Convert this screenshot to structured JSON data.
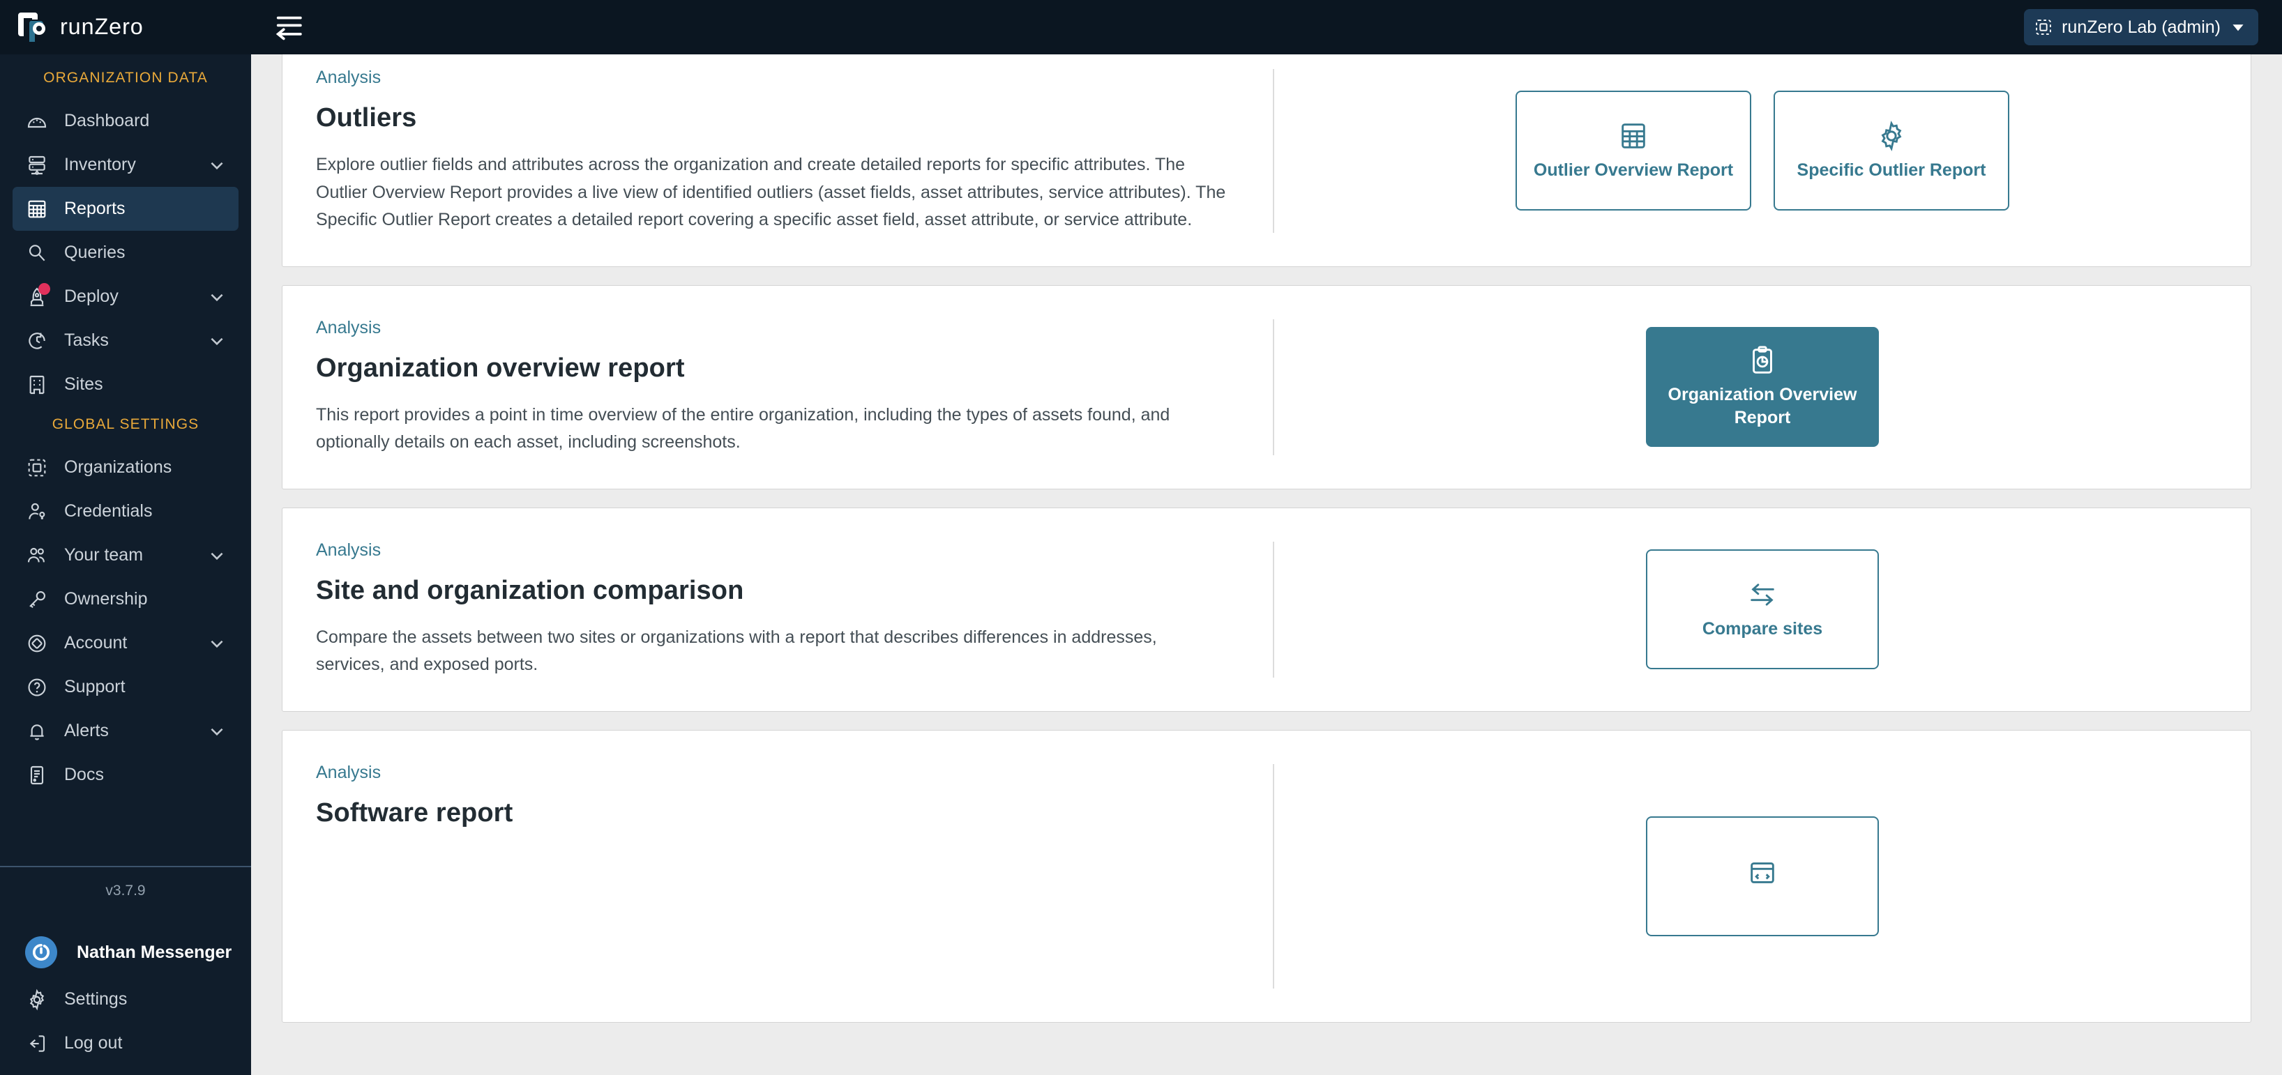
{
  "brand": {
    "name": "runZero",
    "logo_icon": "runzero-logo-icon"
  },
  "topbar": {
    "collapse_icon": "collapse-sidebar-icon",
    "org_selector": {
      "icon": "organization-icon",
      "label": "runZero Lab (admin)",
      "chevron_icon": "chevron-down-icon"
    }
  },
  "sidebar": {
    "sections": [
      {
        "title": "ORGANIZATION DATA",
        "items": [
          {
            "label": "Dashboard",
            "icon": "dashboard-gauge-icon",
            "active": false,
            "expandable": false,
            "badge": false
          },
          {
            "label": "Inventory",
            "icon": "server-stack-icon",
            "active": false,
            "expandable": true,
            "badge": false
          },
          {
            "label": "Reports",
            "icon": "table-grid-icon",
            "active": true,
            "expandable": false,
            "badge": false
          },
          {
            "label": "Queries",
            "icon": "magnifier-icon",
            "active": false,
            "expandable": false,
            "badge": false
          },
          {
            "label": "Deploy",
            "icon": "rocket-icon",
            "active": false,
            "expandable": true,
            "badge": true
          },
          {
            "label": "Tasks",
            "icon": "clock-refresh-icon",
            "active": false,
            "expandable": true,
            "badge": false
          },
          {
            "label": "Sites",
            "icon": "building-icon",
            "active": false,
            "expandable": false,
            "badge": false
          }
        ]
      },
      {
        "title": "GLOBAL SETTINGS",
        "items": [
          {
            "label": "Organizations",
            "icon": "organization-icon",
            "active": false,
            "expandable": false,
            "badge": false
          },
          {
            "label": "Credentials",
            "icon": "user-key-icon",
            "active": false,
            "expandable": false,
            "badge": false
          },
          {
            "label": "Your team",
            "icon": "users-group-icon",
            "active": false,
            "expandable": true,
            "badge": false
          },
          {
            "label": "Ownership",
            "icon": "key-icon",
            "active": false,
            "expandable": false,
            "badge": false
          },
          {
            "label": "Account",
            "icon": "diamond-circle-icon",
            "active": false,
            "expandable": true,
            "badge": false
          },
          {
            "label": "Support",
            "icon": "question-circle-icon",
            "active": false,
            "expandable": false,
            "badge": false
          },
          {
            "label": "Alerts",
            "icon": "bell-icon",
            "active": false,
            "expandable": true,
            "badge": false
          },
          {
            "label": "Docs",
            "icon": "document-icon",
            "active": false,
            "expandable": false,
            "badge": false
          }
        ]
      }
    ],
    "version": "v3.7.9",
    "user": {
      "name": "Nathan Messenger",
      "avatar_icon": "gravatar-avatar"
    },
    "bottom_items": [
      {
        "label": "Settings",
        "icon": "gear-icon"
      },
      {
        "label": "Log out",
        "icon": "logout-icon"
      }
    ]
  },
  "main": {
    "cards": [
      {
        "kicker": "Analysis",
        "title": "Outliers",
        "description": "Explore outlier fields and attributes across the organization and create detailed reports for specific attributes. The Outlier Overview Report provides a live view of identified outliers (asset fields, asset attributes, service attributes). The Specific Outlier Report creates a detailed report covering a specific asset field, asset attribute, or service attribute.",
        "buttons": [
          {
            "label": "Outlier Overview Report",
            "icon": "table-grid-icon",
            "filled": false
          },
          {
            "label": "Specific Outlier Report",
            "icon": "gear-icon",
            "filled": false
          }
        ]
      },
      {
        "kicker": "Analysis",
        "title": "Organization overview report",
        "description": "This report provides a point in time overview of the entire organization, including the types of assets found, and optionally details on each asset, including screenshots.",
        "buttons": [
          {
            "label": "Organization Overview Report",
            "icon": "clipboard-chart-icon",
            "filled": true
          }
        ]
      },
      {
        "kicker": "Analysis",
        "title": "Site and organization comparison",
        "description": "Compare the assets between two sites or organizations with a report that describes differences in addresses, services, and exposed ports.",
        "buttons": [
          {
            "label": "Compare sites",
            "icon": "compare-arrows-icon",
            "filled": false
          }
        ]
      },
      {
        "kicker": "Analysis",
        "title": "Software report",
        "description": "",
        "buttons": [
          {
            "label": "",
            "icon": "software-box-icon",
            "filled": false
          }
        ]
      }
    ]
  },
  "colors": {
    "accent_teal": "#37798f",
    "sidebar_bg": "#101d2b",
    "topbar_bg": "#0b1621",
    "section_title": "#e9a93a",
    "badge": "#e0315c",
    "page_bg": "#ececec"
  }
}
